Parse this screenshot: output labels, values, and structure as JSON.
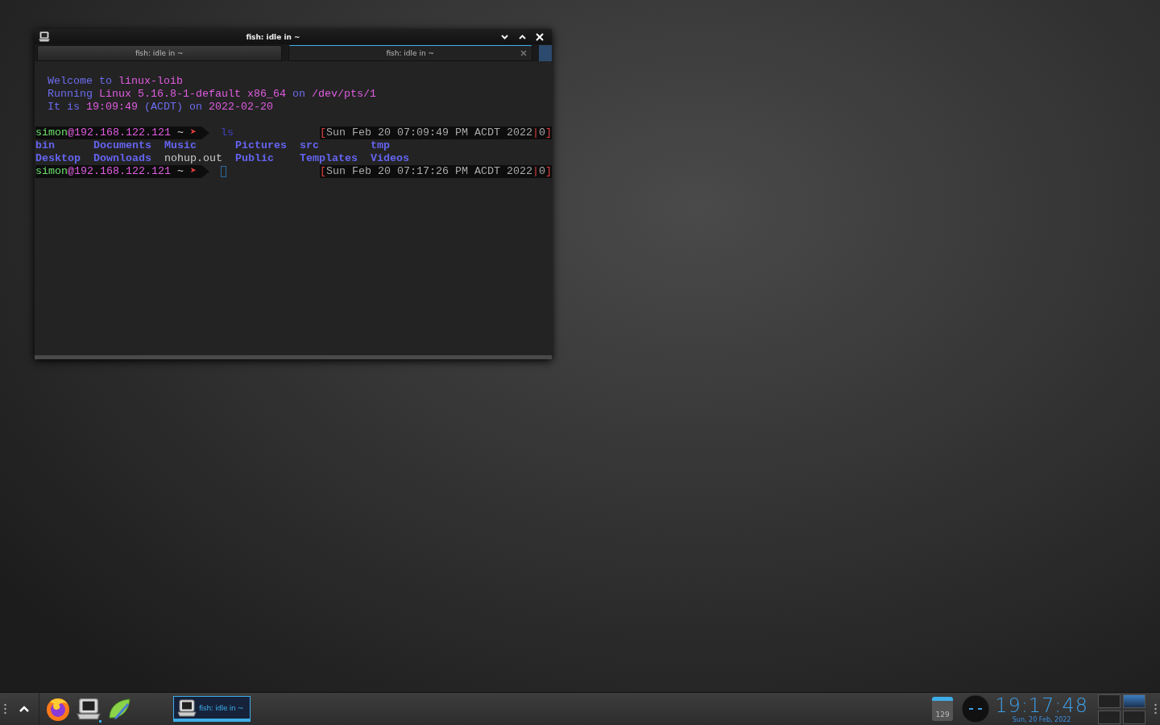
{
  "window": {
    "title": "fish: idle in ~"
  },
  "tabs": [
    {
      "label": "fish: idle in ~",
      "selected": false
    },
    {
      "label": "fish: idle in ~",
      "selected": true
    }
  ],
  "greeting": [
    [
      {
        "text": "Welcome to ",
        "color": "#6c6cf0"
      },
      {
        "text": "linux-loib",
        "color": "#e05ce0"
      }
    ],
    [
      {
        "text": "Running ",
        "color": "#6c6cf0"
      },
      {
        "text": "Linux 5.16.8-1-default x86_64",
        "color": "#e05ce0"
      },
      {
        "text": " on ",
        "color": "#6c6cf0"
      },
      {
        "text": "/dev/pts/1",
        "color": "#e05ce0"
      }
    ],
    [
      {
        "text": "It is ",
        "color": "#6c6cf0"
      },
      {
        "text": "19:09:49",
        "color": "#e05ce0"
      },
      {
        "text": " (ACDT) ",
        "color": "#6c6cf0"
      },
      {
        "text": "on ",
        "color": "#6c6cf0"
      },
      {
        "text": "2022-02-20",
        "color": "#e05ce0"
      }
    ]
  ],
  "session": [
    {
      "kind": "prompt",
      "user": "simon",
      "host": "@192.168.122.121",
      "dir": "~",
      "arrow": "➤",
      "command": "ls",
      "timestamp": "Sun Feb 20 07:09:49 PM ACDT 2022",
      "open": "[",
      "sep": "|",
      "status": "0",
      "close": "]"
    },
    {
      "kind": "listing",
      "rows": [
        [
          {
            "name": "bin",
            "kind": "dir"
          },
          {
            "name": "Documents",
            "kind": "dir"
          },
          {
            "name": "Music",
            "kind": "dir"
          },
          {
            "name": "Pictures",
            "kind": "dir"
          },
          {
            "name": "src",
            "kind": "dir"
          },
          {
            "name": "tmp",
            "kind": "dir"
          }
        ],
        [
          {
            "name": "Desktop",
            "kind": "dir"
          },
          {
            "name": "Downloads",
            "kind": "dir"
          },
          {
            "name": "nohup.out",
            "kind": "file"
          },
          {
            "name": "Public",
            "kind": "dir"
          },
          {
            "name": "Templates",
            "kind": "dir"
          },
          {
            "name": "Videos",
            "kind": "dir"
          }
        ]
      ]
    },
    {
      "kind": "prompt",
      "user": "simon",
      "host": "@192.168.122.121",
      "dir": "~",
      "arrow": "➤",
      "cursor": true,
      "timestamp": "Sun Feb 20 07:17:26 PM ACDT 2022",
      "open": "[",
      "sep": "|",
      "status": "0",
      "close": "]"
    }
  ],
  "taskbar": {
    "launchers": [
      {
        "kind": "browser",
        "running": false
      },
      {
        "kind": "terminal",
        "running": true
      },
      {
        "kind": "editor",
        "running": false
      }
    ],
    "tasks": [
      {
        "label": "fish: idle in ~",
        "selected": true
      }
    ],
    "calendar_count": "129",
    "clock": "19:17:48",
    "date": "Sun, 20 Feb, 2022"
  }
}
